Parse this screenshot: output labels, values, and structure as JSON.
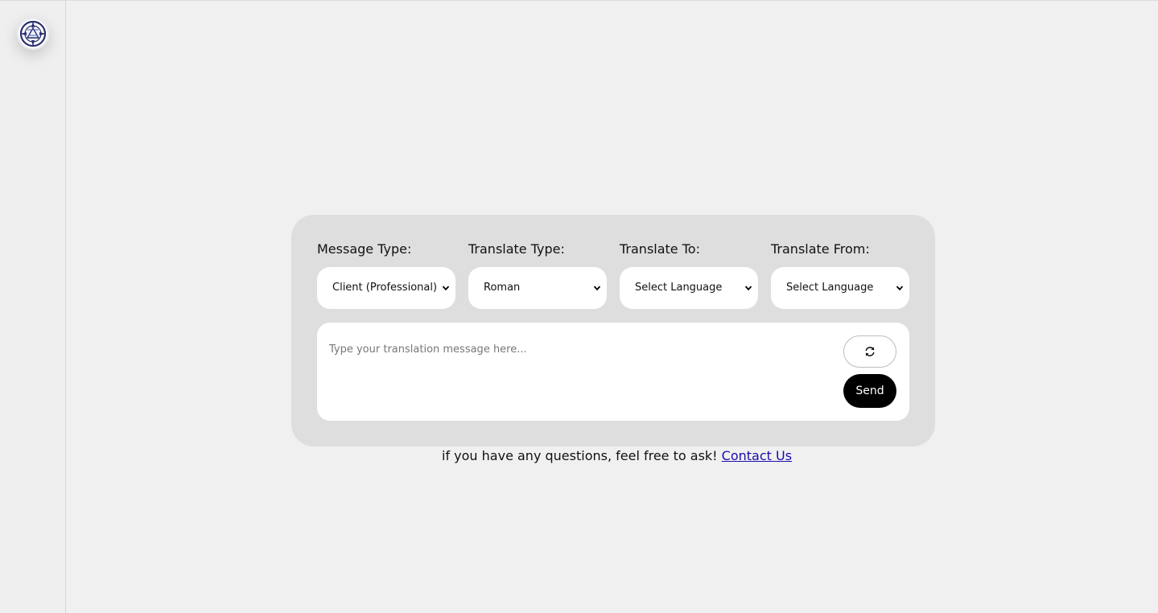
{
  "logo": {
    "icon": "compass-logo-icon"
  },
  "form": {
    "fields": [
      {
        "label": "Message Type:",
        "value": "Client (Professional)"
      },
      {
        "label": "Translate Type:",
        "value": "Roman"
      },
      {
        "label": "Translate To:",
        "value": "Select Language"
      },
      {
        "label": "Translate From:",
        "value": "Select Language"
      }
    ],
    "message_placeholder": "Type your translation message here...",
    "refresh_icon": "refresh-icon",
    "send_label": "Send"
  },
  "footer": {
    "text": "if you have any questions, feel free to ask!",
    "link_label": "Contact Us"
  },
  "colors": {
    "background": "#f0f0f0",
    "card": "#dedede",
    "send_button": "#000000",
    "link": "#1a0dab"
  }
}
